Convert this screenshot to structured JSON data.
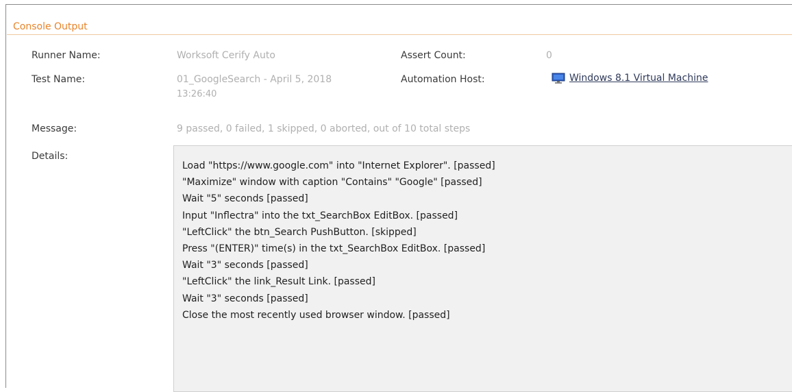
{
  "panel": {
    "title": "Console Output"
  },
  "fields": {
    "runner_name_label": "Runner Name:",
    "runner_name_value": "Worksoft Cerify Auto",
    "assert_count_label": "Assert Count:",
    "assert_count_value": "0",
    "test_name_label": "Test Name:",
    "test_name_value_line1": "01_GoogleSearch - April 5, 2018",
    "test_name_value_line2": "13:26:40",
    "automation_host_label": "Automation Host:",
    "automation_host_value": "Windows 8.1 Virtual Machine",
    "automation_host_icon": "monitor-icon",
    "message_label": "Message:",
    "message_value": "9 passed, 0 failed, 1 skipped, 0 aborted, out of 10 total steps",
    "details_label": "Details:"
  },
  "details": [
    "Load \"https://www.google.com\" into \"Internet Explorer\". [passed]",
    "\"Maximize\" window with caption \"Contains\" \"Google\" [passed]",
    "Wait \"5\" seconds [passed]",
    "Input \"Inflectra\" into the txt_SearchBox EditBox. [passed]",
    "\"LeftClick\" the btn_Search PushButton. [skipped]",
    "Press \"(ENTER)\" time(s) in the txt_SearchBox EditBox. [passed]",
    "Wait \"3\" seconds [passed]",
    "\"LeftClick\" the link_Result Link. [passed]",
    "Wait \"3\" seconds [passed]",
    "Close the most recently used browser window. [passed]"
  ],
  "colors": {
    "title": "#e8842a",
    "label": "#3a3a3a",
    "value": "#b0b0b0",
    "link": "#2f3a5a",
    "details_bg": "#f1f1f1"
  }
}
